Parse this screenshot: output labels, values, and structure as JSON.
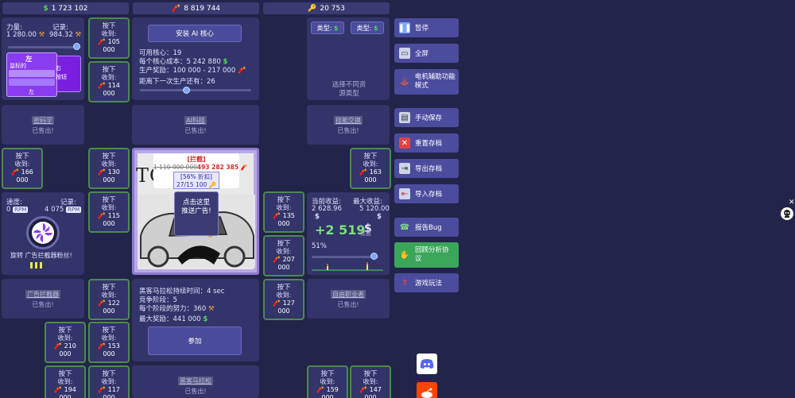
{
  "topbar": {
    "money": "1 723 102",
    "dynamite": "8 819 744",
    "keys": "20 753"
  },
  "strength": {
    "label": "力量:",
    "value": "1 280.00",
    "record_label": "记录:",
    "record_value": "984.32",
    "cards": [
      "左",
      "鼠标的",
      "右",
      "左",
      "左",
      "按钮"
    ]
  },
  "ai_core": {
    "install_button": "安装 AI 核心",
    "available_cores": "可用核心：19",
    "cost_per_core": "每个核心成本：5 242 880",
    "production_reward": "生产奖励：100 000 - 217 000",
    "next_production": "距离下一次生产还有：26"
  },
  "resource_type": {
    "type_label_1": "类型:",
    "type_label_2": "类型:",
    "select_hint": "选择不同资源类型"
  },
  "sold_items": {
    "sold_text": "已售出!",
    "cryptography": "密码学",
    "ai_tech": "AI科技",
    "tech_exchange": "技能交换",
    "ad_blocker": "广告拦截器",
    "freelancer": "自由职业者",
    "hacker_marathon": "黑客马拉松"
  },
  "press": {
    "title": "按下",
    "collect": "收到:"
  },
  "press_buttons": [
    {
      "v1": "105",
      "v2": "000"
    },
    {
      "v1": "114",
      "v2": "000"
    },
    {
      "v1": "166",
      "v2": "000"
    },
    {
      "v1": "130",
      "v2": "000"
    },
    {
      "v1": "115",
      "v2": "000"
    },
    {
      "v1": "163",
      "v2": "000"
    },
    {
      "v1": "135",
      "v2": "000"
    },
    {
      "v1": "207",
      "v2": "000"
    },
    {
      "v1": "122",
      "v2": "000"
    },
    {
      "v1": "127",
      "v2": "000"
    },
    {
      "v1": "210",
      "v2": "000"
    },
    {
      "v1": "153",
      "v2": "000"
    },
    {
      "v1": "194",
      "v2": "000"
    },
    {
      "v1": "117",
      "v2": "000"
    },
    {
      "v1": "159",
      "v2": "000"
    },
    {
      "v1": "147",
      "v2": "000"
    }
  ],
  "speed": {
    "label": "速度:",
    "value": "0",
    "unit": "RPM",
    "record_label": "记录:",
    "record_value": "4 075",
    "fan_text": "旋转 广告拦截器粉丝!"
  },
  "ad": {
    "blocked": "[拦截]",
    "old_price": "1 110 000 000",
    "new_price": "493 282 385",
    "discount": "[56% 折扣]",
    "keys": "27/15 100",
    "bg_text": "TO OBK",
    "click_here": "点击这里推送广告!"
  },
  "income": {
    "current_label": "当前收益:",
    "current_value": "2 628.96",
    "max_label": "最大收益:",
    "max_value": "5 120.00",
    "floating": "+2 519",
    "under_text": "收益",
    "percent": "51%"
  },
  "hacker_marathon": {
    "duration": "黑客马拉松持续时间：4 sec",
    "stage": "竞争阶段：5",
    "effort": "每个阶段的努力：360",
    "max_reward": "最大奖励：441 000",
    "join_button": "参加"
  },
  "side_menu": {
    "pause": "暂停",
    "fullscreen": "全屏",
    "motor_assist": "电机辅助功能模式",
    "manual_save": "手动保存",
    "reset_save": "重置存档",
    "export_save": "导出存档",
    "import_save": "导入存档",
    "report_bug": "报告Bug",
    "analytics": "回顾分析协议",
    "how_to_play": "游戏玩法"
  },
  "colors": {
    "background": "#232449",
    "panel": "#33346a",
    "menu_button": "#4b4c9e",
    "analytics_button": "#3aa65a",
    "press_border": "#4b8a4f",
    "money_green": "#4cd75a"
  }
}
